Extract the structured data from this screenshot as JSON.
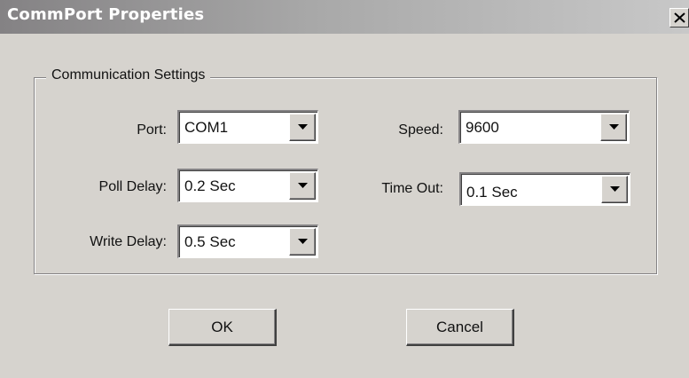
{
  "window": {
    "title": "CommPort Properties",
    "close_icon": "close-icon"
  },
  "group": {
    "title": "Communication Settings"
  },
  "fields": {
    "port": {
      "label": "Port:",
      "value": "COM1"
    },
    "poll_delay": {
      "label": "Poll Delay:",
      "value": "0.2 Sec"
    },
    "write_delay": {
      "label": "Write Delay:",
      "value": "0.5 Sec"
    },
    "speed": {
      "label": "Speed:",
      "value": "9600"
    },
    "time_out": {
      "label": "Time Out:",
      "value": "0.1 Sec"
    }
  },
  "buttons": {
    "ok": "OK",
    "cancel": "Cancel"
  },
  "colors": {
    "face": "#d6d3ce",
    "title_bar_start": "#848284",
    "title_bar_end": "#c8c8c8",
    "title_text": "#ffffff"
  }
}
